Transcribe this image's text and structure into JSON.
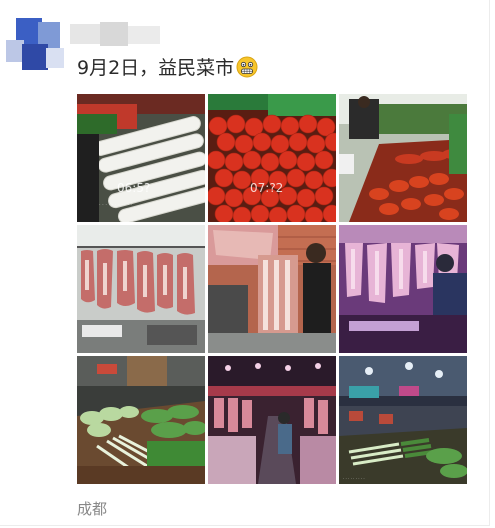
{
  "post": {
    "text": "9月2日，益民菜市",
    "emoji": "grimacing-face-emoji"
  },
  "photos": [
    {
      "subject": "white radishes and red chili",
      "overlay_time": "06:5?"
    },
    {
      "subject": "tomatoes",
      "overlay_time": "07:?2"
    },
    {
      "subject": "vegetable stall with shopper",
      "overlay_time": ""
    },
    {
      "subject": "hanging pork cuts",
      "overlay_time": ""
    },
    {
      "subject": "butcher with pork slab",
      "overlay_time": ""
    },
    {
      "subject": "pork under pink light",
      "overlay_time": ""
    },
    {
      "subject": "green vegetables stall",
      "overlay_time": ""
    },
    {
      "subject": "meat market aisle",
      "overlay_time": ""
    },
    {
      "subject": "market interior with leeks",
      "overlay_time": ""
    }
  ],
  "location": "成都",
  "colors": {
    "text_primary": "#2b2b2b",
    "text_secondary": "#888888",
    "background": "#ffffff"
  }
}
